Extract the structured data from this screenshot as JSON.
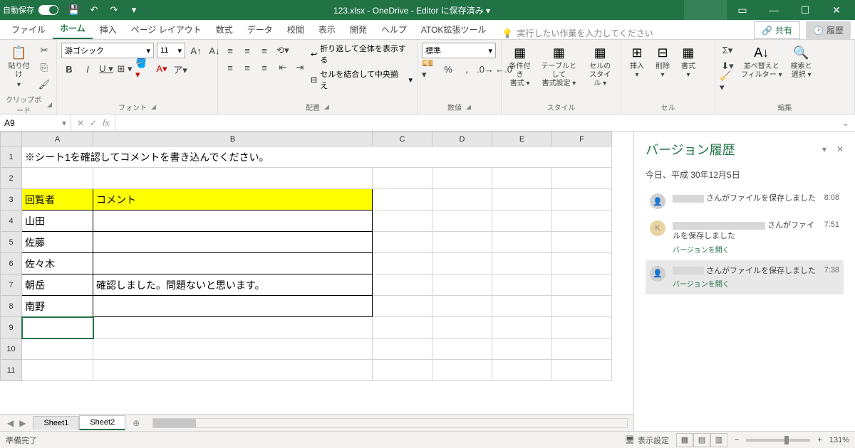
{
  "titlebar": {
    "autosave_label": "自動保存",
    "autosave_state": "オン",
    "title": "123.xlsx - OneDrive - Editor に保存済み ▾"
  },
  "tabs": {
    "file": "ファイル",
    "home": "ホーム",
    "insert": "挿入",
    "layout": "ページ レイアウト",
    "formulas": "数式",
    "data": "データ",
    "review": "校閲",
    "view": "表示",
    "developer": "開発",
    "help": "ヘルプ",
    "atok": "ATOK拡張ツール",
    "search_placeholder": "実行したい作業を入力してください",
    "share": "共有",
    "history": "履歴"
  },
  "ribbon": {
    "clipboard": {
      "paste": "貼り付け",
      "label": "クリップボード"
    },
    "font": {
      "name": "游ゴシック",
      "size": "11",
      "label": "フォント"
    },
    "align": {
      "wrap": "折り返して全体を表示する",
      "merge": "セルを結合して中央揃え",
      "label": "配置"
    },
    "number": {
      "format": "標準",
      "label": "数値"
    },
    "style": {
      "cond": "条件付き\n書式 ▾",
      "table": "テーブルとして\n書式設定 ▾",
      "cell": "セルの\nスタイル ▾",
      "label": "スタイル"
    },
    "cells": {
      "insert": "挿入\n▾",
      "delete": "削除\n▾",
      "format": "書式\n▾",
      "label": "セル"
    },
    "edit": {
      "sort": "並べ替えと\nフィルター ▾",
      "find": "検索と\n選択 ▾",
      "label": "編集"
    }
  },
  "namebox": "A9",
  "sheet": {
    "cols": [
      "A",
      "B",
      "C",
      "D",
      "E",
      "F"
    ],
    "note": "※シート1を確認してコメントを書き込んでください。",
    "header_a": "回覧者",
    "header_b": "コメント",
    "rows": [
      {
        "a": "山田",
        "b": ""
      },
      {
        "a": "佐藤",
        "b": ""
      },
      {
        "a": "佐々木",
        "b": ""
      },
      {
        "a": "朝岳",
        "b": "確認しました。問題ないと思います。"
      },
      {
        "a": "南野",
        "b": ""
      }
    ],
    "tabs": [
      "Sheet1",
      "Sheet2"
    ],
    "active_tab": 1
  },
  "version_panel": {
    "title": "バージョン履歴",
    "date": "今日、平成 30年12月5日",
    "entries": [
      {
        "text_suffix": "さんがファイルを保存しました",
        "time": "8:08",
        "link": ""
      },
      {
        "avatar": "K",
        "text_suffix": "さんがファイルを保存しました",
        "time": "7:51",
        "link": "バージョンを開く"
      },
      {
        "text_suffix": "さんがファイルを保存しました",
        "time": "7:38",
        "link": "バージョンを開く",
        "selected": true
      }
    ]
  },
  "statusbar": {
    "ready": "準備完了",
    "display": "表示設定",
    "zoom": "131%"
  }
}
